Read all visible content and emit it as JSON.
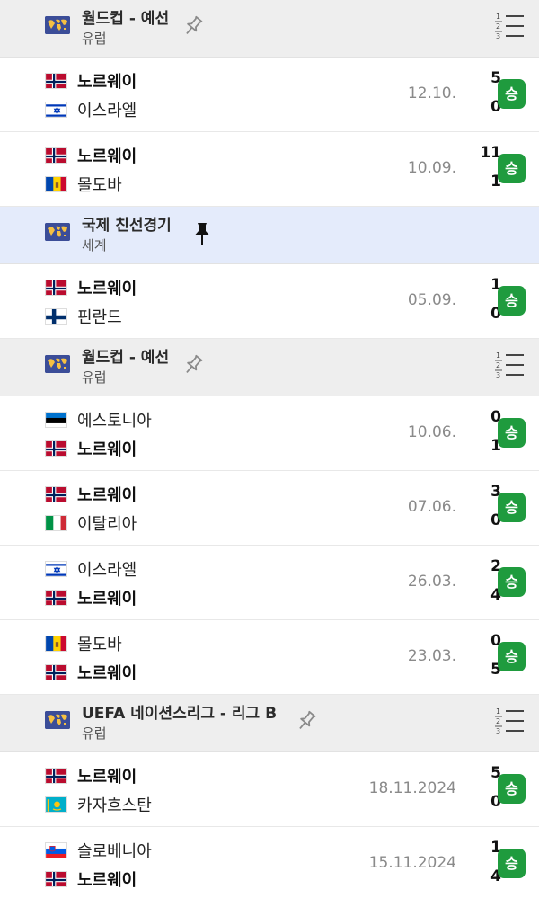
{
  "groups": [
    {
      "league": {
        "name": "월드컵 - 예선",
        "region": "유럽",
        "pin": "pin-outline-icon",
        "standings": "standings-icon",
        "highlight": false
      },
      "matches": [
        {
          "home": {
            "name": "노르웨이",
            "flag": "norway",
            "score": "5",
            "winner": true
          },
          "away": {
            "name": "이스라엘",
            "flag": "israel",
            "score": "0",
            "winner": false
          },
          "date": "12.10.",
          "result": "승"
        },
        {
          "home": {
            "name": "노르웨이",
            "flag": "norway",
            "score": "11",
            "winner": true
          },
          "away": {
            "name": "몰도바",
            "flag": "moldova",
            "score": "1",
            "winner": false
          },
          "date": "10.09.",
          "result": "승"
        }
      ]
    },
    {
      "league": {
        "name": "국제 친선경기",
        "region": "세계",
        "pin": "pin-filled-icon",
        "standings": "",
        "highlight": true
      },
      "matches": [
        {
          "home": {
            "name": "노르웨이",
            "flag": "norway",
            "score": "1",
            "winner": true
          },
          "away": {
            "name": "핀란드",
            "flag": "finland",
            "score": "0",
            "winner": false
          },
          "date": "05.09.",
          "result": "승"
        }
      ]
    },
    {
      "league": {
        "name": "월드컵 - 예선",
        "region": "유럽",
        "pin": "pin-outline-icon",
        "standings": "standings-icon",
        "highlight": false
      },
      "matches": [
        {
          "home": {
            "name": "에스토니아",
            "flag": "estonia",
            "score": "0",
            "winner": false
          },
          "away": {
            "name": "노르웨이",
            "flag": "norway",
            "score": "1",
            "winner": true
          },
          "date": "10.06.",
          "result": "승"
        },
        {
          "home": {
            "name": "노르웨이",
            "flag": "norway",
            "score": "3",
            "winner": true
          },
          "away": {
            "name": "이탈리아",
            "flag": "italy",
            "score": "0",
            "winner": false
          },
          "date": "07.06.",
          "result": "승"
        },
        {
          "home": {
            "name": "이스라엘",
            "flag": "israel",
            "score": "2",
            "winner": false
          },
          "away": {
            "name": "노르웨이",
            "flag": "norway",
            "score": "4",
            "winner": true
          },
          "date": "26.03.",
          "result": "승"
        },
        {
          "home": {
            "name": "몰도바",
            "flag": "moldova",
            "score": "0",
            "winner": false
          },
          "away": {
            "name": "노르웨이",
            "flag": "norway",
            "score": "5",
            "winner": true
          },
          "date": "23.03.",
          "result": "승"
        }
      ]
    },
    {
      "league": {
        "name": "UEFA 네이션스리그 - 리그 B",
        "region": "유럽",
        "pin": "pin-outline-icon",
        "standings": "standings-icon",
        "highlight": false
      },
      "matches": [
        {
          "home": {
            "name": "노르웨이",
            "flag": "norway",
            "score": "5",
            "winner": true
          },
          "away": {
            "name": "카자흐스탄",
            "flag": "kazakhstan",
            "score": "0",
            "winner": false
          },
          "date": "18.11.2024",
          "result": "승"
        },
        {
          "home": {
            "name": "슬로베니아",
            "flag": "slovenia",
            "score": "1",
            "winner": false
          },
          "away": {
            "name": "노르웨이",
            "flag": "norway",
            "score": "4",
            "winner": true
          },
          "date": "15.11.2024",
          "result": "승"
        }
      ]
    }
  ],
  "colors": {
    "win_badge": "#1f9b3e",
    "league_bg": "#eeeeee",
    "league_highlight_bg": "#e4ebfb"
  }
}
